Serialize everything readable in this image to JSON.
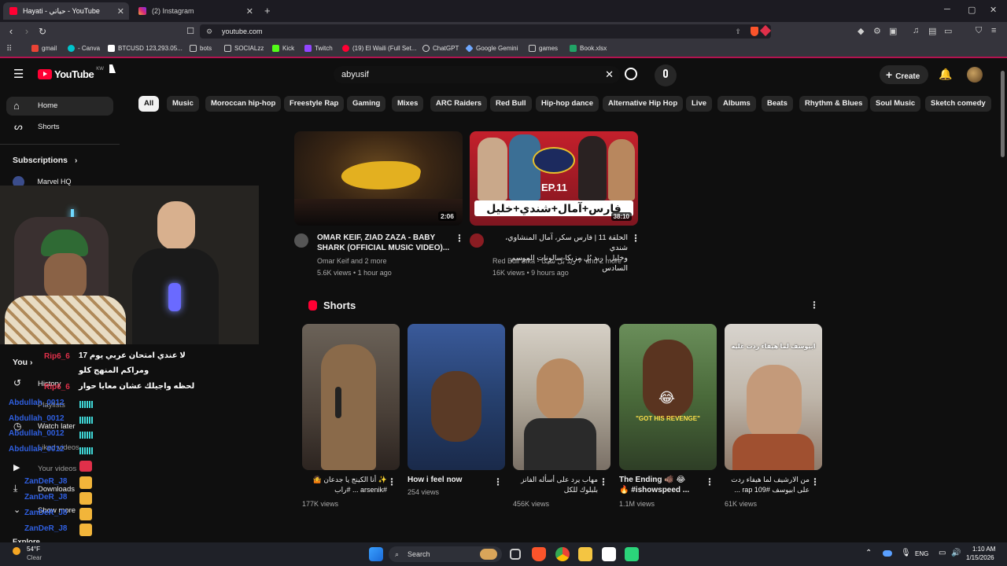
{
  "browser": {
    "tabs": [
      {
        "label": "Hayati - حياتي - YouTube",
        "active": true
      },
      {
        "label": "(2) Instagram",
        "active": false
      }
    ],
    "url": "youtube.com",
    "bookmarks": [
      "gmail",
      "- Canva",
      "BTCUSD 123,293.05...",
      "bots",
      "SOCIALzz",
      "Kick",
      "Twitch",
      "(19) El Waili (Full Set...",
      "ChatGPT",
      "Google Gemini",
      "games",
      "Book.xlsx"
    ]
  },
  "youtube": {
    "logo_text": "YouTube",
    "region": "KW",
    "search_value": "abyusif",
    "create_label": "Create",
    "chips": [
      "All",
      "Music",
      "Moroccan hip-hop",
      "Freestyle Rap",
      "Gaming",
      "Mixes",
      "ARC Raiders",
      "Red Bull",
      "Hip-hop dance",
      "Alternative Hip Hop",
      "Live",
      "Albums",
      "Beats",
      "Rhythm & Blues",
      "Soul Music",
      "Sketch comedy"
    ],
    "sidebar": {
      "home": "Home",
      "shorts": "Shorts",
      "subscriptions": "Subscriptions",
      "sub_channel": "Marvel HQ",
      "you": "You",
      "history": "History",
      "playlists": "Playlists",
      "watch_later": "Watch later",
      "liked": "Liked videos",
      "your_videos": "Your videos",
      "downloads": "Downloads",
      "show_more": "Show more",
      "explore": "Explore"
    },
    "videos": [
      {
        "title_line1": "OMAR KEIF, ZIAD ZAZA - BABY",
        "title_line2": "SHARK (OFFICIAL MUSIC VIDEO)...",
        "channel": "Omar Keif and 2 more",
        "meta": "5.6K views • 1 hour ago",
        "duration": "2:06"
      },
      {
        "title_line1": "الحلقة 11 | فارس سكر، آمال المنشاوي، شندي",
        "title_line2": "وخليل | ريد بُل مزيكا سالونات الموسم السادس",
        "channel": "Red Bull Sika - ريد بُل سيكا",
        "channel_more": "and 2 more",
        "meta": "16K views • 9 hours ago",
        "duration": "38:10",
        "thumb_title": "فارس+آمال+شندي+خليل",
        "thumb_ep": "EP.11"
      }
    ],
    "shorts_label": "Shorts",
    "shorts": [
      {
        "title_line1": "✨ أنا الكينج يا جدعان 🤷",
        "title_line2": "#arsenik ... #راب",
        "views": "177K views"
      },
      {
        "title_line1": "How i feel now",
        "title_line2": "",
        "views": "254 views"
      },
      {
        "title_line1": "مهاب يرد على أسأله الفانز",
        "title_line2": "بلبلوك للكل",
        "views": "456K views"
      },
      {
        "title_line1": "The Ending 🐗 😂",
        "title_line2": "🔥 #ishowspeed ...",
        "views": "1.1M views",
        "caption": "\"GOT HIS REVENGE\""
      },
      {
        "title_line1": "من الارشيف لما هيفاء ردت",
        "title_line2": "على ابيوسف #109 rap ...",
        "views": "61K views",
        "caption": "ابيوسف لما هيفاء ردت عليه"
      }
    ]
  },
  "stream_chat": [
    {
      "user": "Rip6_6",
      "text": "لا عندي امتحان عربي يوم 17"
    },
    {
      "user": "",
      "text": "ومراكم المنهج كلو"
    },
    {
      "user": "Rip6_6",
      "text": "لحظه واجيلك عشان معايا حوار"
    },
    {
      "user": "Abdullah_0012",
      "text": ""
    },
    {
      "user": "Abdullah_0012",
      "text": ""
    },
    {
      "user": "Abdullah_0012",
      "text": ""
    },
    {
      "user": "Abdullah_0012",
      "text": ""
    },
    {
      "user": "ZanDeR_J8",
      "text": ""
    },
    {
      "user": "ZanDeR_J8",
      "text": ""
    },
    {
      "user": "ZanDeR_J8",
      "text": ""
    },
    {
      "user": "ZanDeR_J8",
      "text": ""
    }
  ],
  "taskbar": {
    "weather_temp": "54°F",
    "weather_desc": "Clear",
    "search": "Search",
    "lang": "ENG",
    "time": "1:10 AM",
    "date": "1/15/2026"
  },
  "colors": {
    "youtube_red": "#ff0033",
    "accent_pink": "#b3124f",
    "chat_red": "#e0304a",
    "chat_blue": "#2f5fe0"
  }
}
